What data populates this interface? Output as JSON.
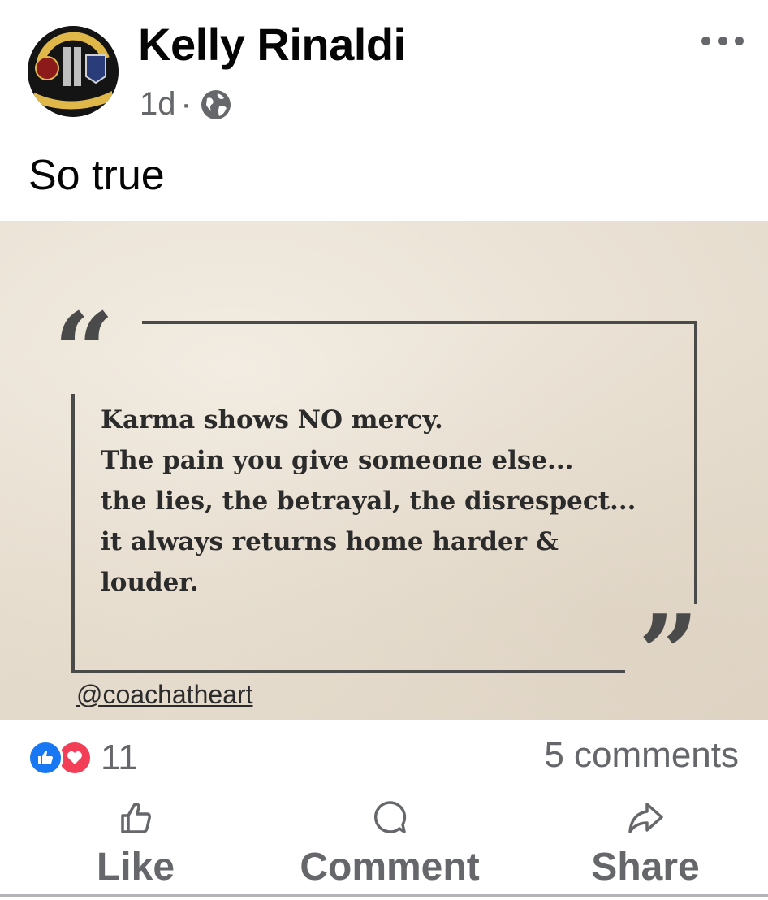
{
  "post": {
    "author": "Kelly Rinaldi",
    "time": "1d",
    "separator": "·",
    "privacy_icon": "globe-icon",
    "caption": "So true",
    "avatar": {
      "icon": "memorial-badge-avatar",
      "badge_text": [
        "GONE",
        "BUT",
        "NOT FORGOTTEN",
        "9-11-01"
      ],
      "patches": [
        "FDNY",
        "NYPD"
      ]
    }
  },
  "shared_image": {
    "quote_lines": [
      "Karma shows NO mercy.",
      "The pain you give someone else...",
      "the lies, the betrayal, the disrespect...",
      "it always returns home harder &",
      "louder."
    ],
    "open_quote": "“",
    "close_quote": "”",
    "handle": "@coachatheart"
  },
  "engagement": {
    "reaction_icons": [
      "like-reaction-icon",
      "love-reaction-icon"
    ],
    "reaction_count": "11",
    "comments": "5 comments"
  },
  "actions": {
    "like": "Like",
    "comment": "Comment",
    "share": "Share"
  },
  "colors": {
    "like_blue": "#1877f2",
    "love_red": "#f33e58",
    "secondary_text": "#65676b"
  }
}
